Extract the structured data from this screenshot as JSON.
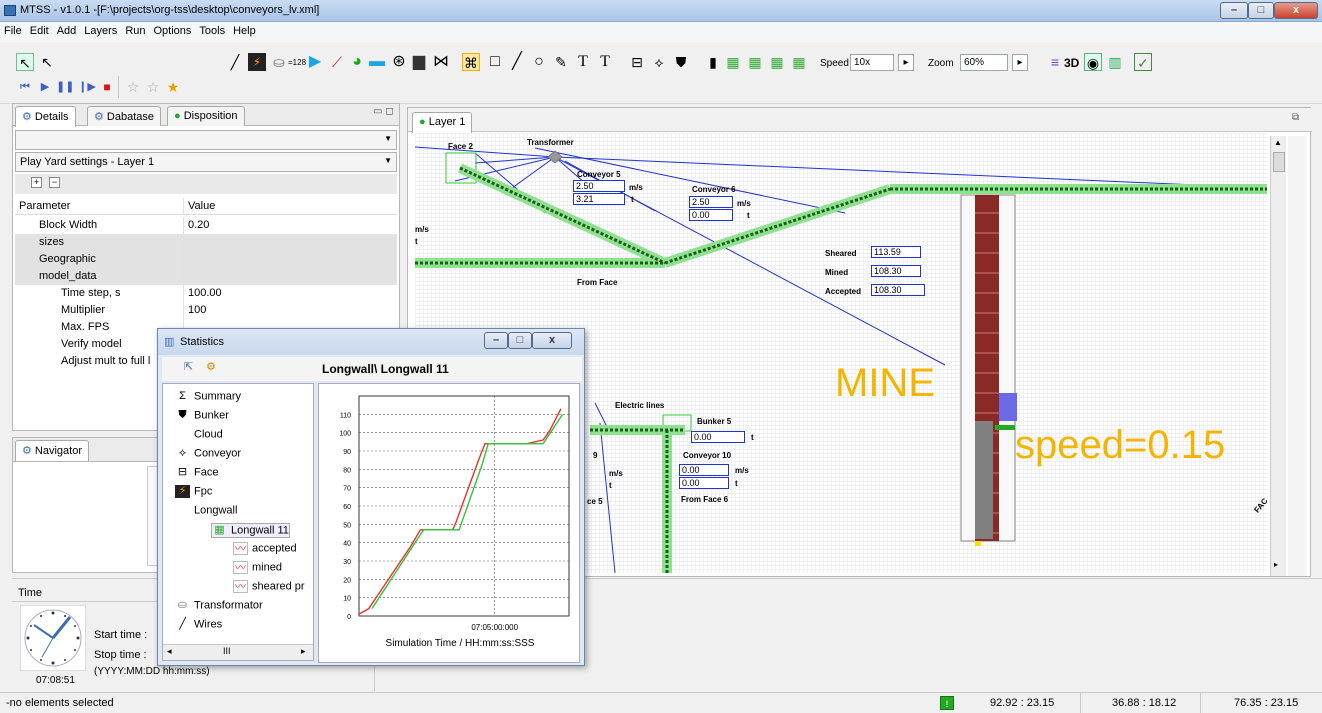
{
  "window": {
    "title": "MTSS - v1.0.1  -[F:\\projects\\org-tss\\desktop\\conveyors_lv.xml]"
  },
  "menu": [
    "File",
    "Edit",
    "Add",
    "Layers",
    "Run",
    "Options",
    "Tools",
    "Help"
  ],
  "toolbar": {
    "wire_width": "=128",
    "speed_label": "Speed",
    "speed_value": "10x",
    "zoom_label": "Zoom",
    "zoom_value": "60%",
    "view3d_label": "3D",
    "text_tool_1": "T",
    "text_tool_2": "T"
  },
  "left_panel": {
    "tabs": [
      "Details",
      "Dabatase",
      "Disposition"
    ],
    "combo1": "",
    "combo2": "Play Yard settings - Layer 1",
    "headers": {
      "param": "Parameter",
      "value": "Value"
    },
    "rows": [
      {
        "param": "Block Width",
        "value": "0.20"
      },
      {
        "param": "sizes",
        "value": ""
      },
      {
        "param": "Geographic",
        "value": ""
      },
      {
        "param": "model_data",
        "value": ""
      },
      {
        "param": "Time step, s",
        "value": "100.00"
      },
      {
        "param": "Multiplier",
        "value": "100"
      },
      {
        "param": "Max. FPS",
        "value": ""
      },
      {
        "param": "Verify model",
        "value": ""
      },
      {
        "param": "Adjust mult to full l",
        "value": ""
      }
    ]
  },
  "navigator": {
    "title": "Navigator"
  },
  "layer": {
    "tab": "Layer 1"
  },
  "canvas": {
    "face2": "Face 2",
    "transformer": "Transformer",
    "conveyor5": "Conveyor 5",
    "c5_speed": "2.50",
    "c5_load": "3.21",
    "conveyor6": "Conveyor 6",
    "c6_speed": "2.50",
    "c6_load": "0.00",
    "unit_speed": "m/s",
    "unit_t": "t",
    "left_unit": "m/s",
    "left_t": "t",
    "from_face": "From Face",
    "sheared_label": "Sheared",
    "sheared_value": "113.59",
    "mined_label": "Mined",
    "mined_value": "108.30",
    "accepted_label": "Accepted",
    "accepted_value": "108.30",
    "mine": "MINE",
    "speed": "speed=0.15",
    "electric": "Electric lines",
    "bunker5": "Bunker 5",
    "bunker5_value": "0.00",
    "conveyor10": "Conveyor 10",
    "c10_speed": "0.00",
    "c10_load": "0.00",
    "from_face6": "From Face 6",
    "frag_9": "9",
    "frag_face5": "ce 5",
    "frag_fac": "FAC"
  },
  "stats": {
    "title": "Statistics",
    "chart_title": "Longwall\\ Longwall 11",
    "tree": [
      "Summary",
      "Bunker",
      "Cloud",
      "Conveyor",
      "Face",
      "Fpc",
      "Longwall",
      "Longwall 11",
      "accepted",
      "mined",
      "sheared pr",
      "Transformator",
      "Wires"
    ],
    "scroll_mark": "III"
  },
  "chart_data": {
    "type": "line",
    "title": "",
    "xlabel": "Simulation Time / HH:mm:ss:SSS",
    "ylabel": "",
    "x_tick_labels": [
      "07:05:00:000"
    ],
    "yticks": [
      0,
      10,
      20,
      30,
      40,
      50,
      60,
      70,
      80,
      90,
      100,
      110
    ],
    "ylim": [
      0,
      120
    ],
    "grid": true,
    "series": [
      {
        "color": "#e8322a",
        "x": [
          0,
          0.06,
          0.32,
          0.38,
          0.58,
          0.6,
          0.74,
          0.78,
          0.94,
          1.04,
          1.14,
          1.18,
          1.25
        ],
        "values": [
          1,
          4,
          38,
          47,
          47,
          51,
          85,
          94,
          94,
          94,
          96,
          101,
          113
        ]
      },
      {
        "color": "#31c43a",
        "x": [
          0.08,
          0.34,
          0.4,
          0.56,
          0.62,
          0.76,
          0.8,
          0.94,
          1.1,
          1.14,
          1.26
        ],
        "values": [
          4,
          39,
          47,
          47,
          47,
          82,
          94,
          94,
          94,
          94,
          110
        ]
      }
    ]
  },
  "time_panel": {
    "title": "Time",
    "start": "Start time :",
    "stop": "Stop time :",
    "format": "(YYYY:MM:DD hh:mm:ss)",
    "clock": "07:08:51"
  },
  "status": {
    "message": "-no elements selected",
    "coord1": "92.92 : 23.15",
    "coord2": "36.88 : 18.12",
    "coord3": "76.35 : 23.15"
  },
  "colors": {
    "conveyor": "#5ccb5c",
    "blue_line": "#2233cc",
    "mine_text": "#f4b400",
    "shaft": "#8b2a24"
  }
}
